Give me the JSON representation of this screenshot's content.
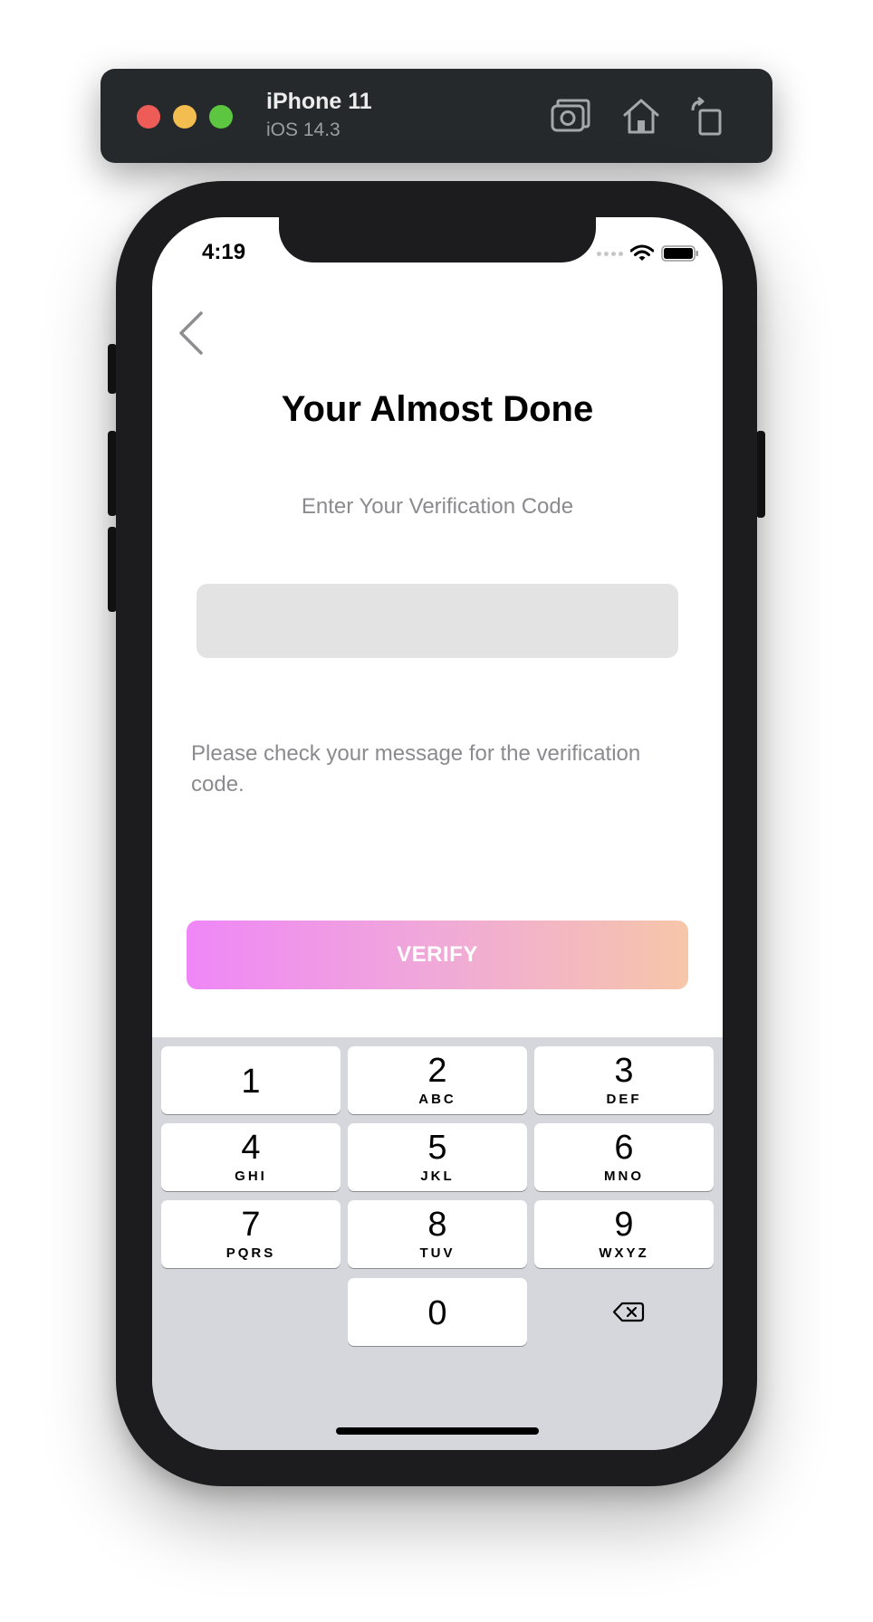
{
  "simulator": {
    "device_name": "iPhone 11",
    "os_version": "iOS 14.3"
  },
  "status_bar": {
    "time": "4:19"
  },
  "screen": {
    "title": "Your Almost Done",
    "subtitle": "Enter Your Verification Code",
    "code_input_value": "",
    "hint": "Please check your message for the verification code.",
    "verify_label": "VERIFY"
  },
  "colors": {
    "button_gradient_start": "#ef87f7",
    "button_gradient_end": "#f6c6a9",
    "input_bg": "#e3e3e4",
    "keyboard_bg": "#d5d7dc"
  },
  "keypad": {
    "keys": [
      {
        "digit": "1",
        "letters": ""
      },
      {
        "digit": "2",
        "letters": "ABC"
      },
      {
        "digit": "3",
        "letters": "DEF"
      },
      {
        "digit": "4",
        "letters": "GHI"
      },
      {
        "digit": "5",
        "letters": "JKL"
      },
      {
        "digit": "6",
        "letters": "MNO"
      },
      {
        "digit": "7",
        "letters": "PQRS"
      },
      {
        "digit": "8",
        "letters": "TUV"
      },
      {
        "digit": "9",
        "letters": "WXYZ"
      },
      {
        "digit": "0",
        "letters": ""
      }
    ],
    "delete_icon": "delete-backspace-icon"
  }
}
